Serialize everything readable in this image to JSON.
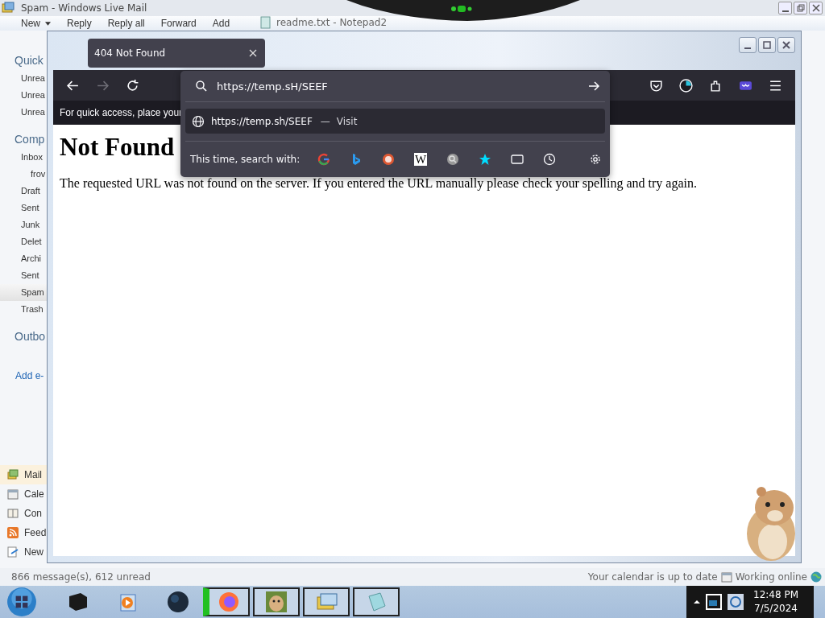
{
  "mail_window": {
    "title": "Spam - Windows Live Mail",
    "toolbar": [
      {
        "label": "New",
        "dropdown": true
      },
      {
        "label": "Reply",
        "dropdown": false
      },
      {
        "label": "Reply all",
        "dropdown": false
      },
      {
        "label": "Forward",
        "dropdown": false
      },
      {
        "label": "Add",
        "dropdown": false
      }
    ],
    "behind_window_title": "readme.txt - Notepad2",
    "sidebar": [
      {
        "heading": "Quick",
        "items": [
          {
            "label": "Unrea",
            "selected": false
          },
          {
            "label": "Unrea",
            "selected": false
          },
          {
            "label": "Unrea",
            "selected": false
          }
        ]
      },
      {
        "heading": "Comp",
        "items": [
          {
            "label": "Inbox",
            "selected": false,
            "children": [
              {
                "label": "frov",
                "selected": false
              }
            ]
          },
          {
            "label": "Draft",
            "selected": false
          },
          {
            "label": "Sent",
            "selected": false
          },
          {
            "label": "Junk",
            "selected": false
          },
          {
            "label": "Delet",
            "selected": false
          },
          {
            "label": "Archi",
            "selected": false
          },
          {
            "label": "Sent",
            "selected": false
          },
          {
            "label": "Spam",
            "selected": true
          },
          {
            "label": "Trash",
            "selected": false
          }
        ]
      },
      {
        "heading": "Outbo"
      }
    ],
    "add_account_link": "Add e-",
    "nav": [
      {
        "label": "Mail",
        "kind": "mail",
        "selected": true
      },
      {
        "label": "Cale",
        "kind": "calendar",
        "selected": false
      },
      {
        "label": "Con",
        "kind": "contacts",
        "selected": false
      },
      {
        "label": "Feed",
        "kind": "feeds",
        "selected": false
      },
      {
        "label": "New",
        "kind": "newsgroups",
        "selected": false
      }
    ],
    "status_bar": {
      "messages": "866 message(s), 612 unread",
      "calendar": "Your calendar is up to date",
      "connection": "Working online"
    }
  },
  "browser": {
    "tab": {
      "title": "404 Not Found"
    },
    "forward_disabled": true,
    "bookmarks_hint": "For quick access, place your",
    "urlbar": {
      "value": "https://temp.sH/SEEF"
    },
    "suggestion": {
      "url": "https://temp.sh/SEEF",
      "separator": "—",
      "action": "Visit"
    },
    "search_with": {
      "label": "This time, search with:",
      "engines": [
        {
          "kind": "google"
        },
        {
          "kind": "bing"
        },
        {
          "kind": "duckduckgo"
        },
        {
          "kind": "wikipedia",
          "glyph": "W"
        },
        {
          "kind": "search"
        },
        {
          "kind": "bookmarks"
        },
        {
          "kind": "tabs"
        },
        {
          "kind": "history"
        }
      ]
    },
    "page": {
      "heading": "Not Found",
      "message": "The requested URL was not found on the server. If you entered the URL manually please check your spelling and try again."
    }
  },
  "taskbar": {
    "clock": {
      "time": "12:48 PM",
      "date": "7/5/2024"
    }
  }
}
